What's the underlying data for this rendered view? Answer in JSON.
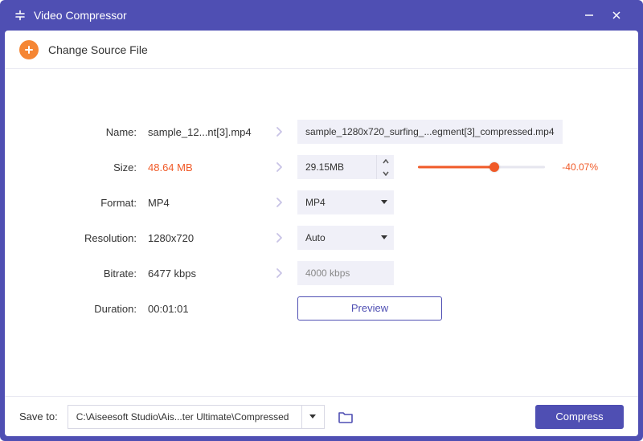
{
  "window": {
    "title": "Video Compressor"
  },
  "header": {
    "change_source_label": "Change Source File"
  },
  "labels": {
    "name": "Name:",
    "size": "Size:",
    "format": "Format:",
    "resolution": "Resolution:",
    "bitrate": "Bitrate:",
    "duration": "Duration:"
  },
  "source": {
    "name": "sample_12...nt[3].mp4",
    "size": "48.64 MB",
    "format": "MP4",
    "resolution": "1280x720",
    "bitrate": "6477 kbps",
    "duration": "00:01:01"
  },
  "output": {
    "name": "sample_1280x720_surfing_...egment[3]_compressed.mp4",
    "size": "29.15MB",
    "format": "MP4",
    "resolution": "Auto",
    "bitrate": "4000 kbps",
    "reduction_pct_text": "-40.07%",
    "slider_fill_pct": 60
  },
  "preview_button": "Preview",
  "footer": {
    "save_to_label": "Save to:",
    "save_path": "C:\\Aiseesoft Studio\\Ais...ter Ultimate\\Compressed",
    "compress_button": "Compress"
  }
}
